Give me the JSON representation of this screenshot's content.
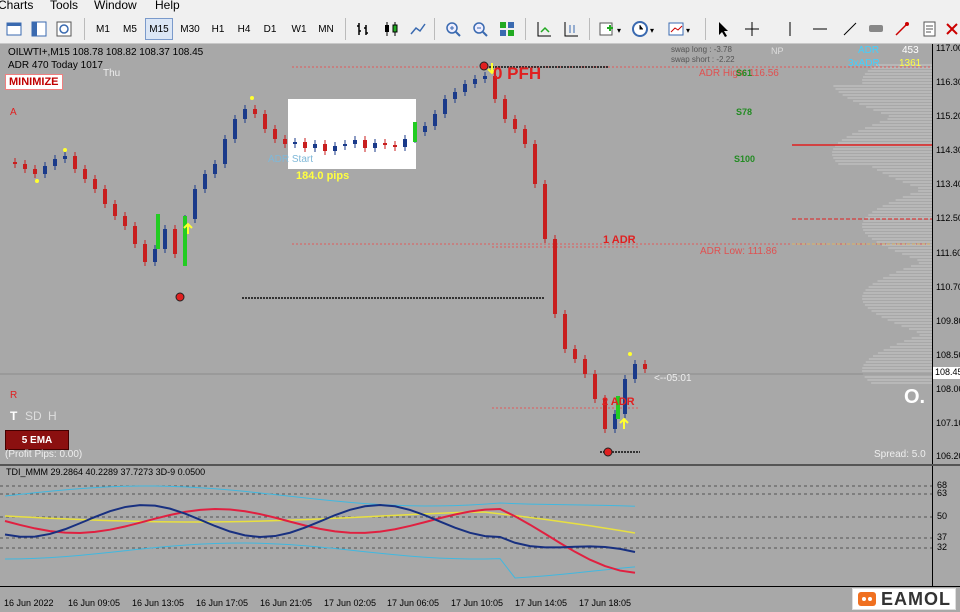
{
  "menu": {
    "items": [
      "Charts",
      "Tools",
      "Window",
      "Help"
    ]
  },
  "timeframes": [
    "M1",
    "M5",
    "M15",
    "M30",
    "H1",
    "H4",
    "D1",
    "W1",
    "MN"
  ],
  "active_timeframe": "M15",
  "header": {
    "symbol_line": "OILWTI+,M15  108.78 108.82 108.37 108.45",
    "adr_line": "ADR 470  Today 1017",
    "day": "Thu",
    "minimize": "MINIMIZE",
    "label_a": "A",
    "np": "NP",
    "swap_long": "swap long : -3.78",
    "swap_short": "swap short : -2.22",
    "adr_label": "ADR",
    "adr_value": "453",
    "x3adr_label": "3xADR",
    "x3adr_value": "1361",
    "adr_high": "ADR High: 116.56",
    "s61": "S61",
    "s78": "S78",
    "s100": "S100",
    "pfh": "0 PFH",
    "one_adr": "1 ADR",
    "adr_low": "ADR Low: 111.86",
    "two_adr": "2 ADR",
    "adr_start": "ADR Start",
    "pips": "184.0 pips",
    "countdown": "<--05:01",
    "big_o": "O.",
    "label_r": "R",
    "tabs": [
      "T",
      "SD",
      "H"
    ],
    "ema_button": "5 EMA",
    "profit_pips": "(Profit Pips: 0.00)",
    "spread": "Spread: 5.0"
  },
  "price_axis": {
    "labels": [
      "117.00",
      "116.30",
      "115.20",
      "114.30",
      "113.40",
      "112.50",
      "111.60",
      "110.70",
      "109.80",
      "108.50",
      "108.00",
      "107.10",
      "106.20"
    ],
    "current": "108.45"
  },
  "indicator": {
    "title": "TDI_MMM 29.2864 40.2289 37.7273  3D-9 0.0500",
    "levels": [
      "68",
      "63",
      "50",
      "37",
      "32"
    ]
  },
  "time_axis": [
    "16 Jun 2022",
    "16 Jun 09:05",
    "16 Jun 13:05",
    "16 Jun 17:05",
    "16 Jun 21:05",
    "17 Jun 02:05",
    "17 Jun 06:05",
    "17 Jun 10:05",
    "17 Jun 14:05",
    "17 Jun 18:05"
  ],
  "brand": "EAMOL",
  "colors": {
    "bull": "#1a3a8a",
    "bear": "#c81e1e",
    "green_bar": "#22cc22",
    "adr_line": "#e04040",
    "price_line_gray": "#555555"
  }
}
